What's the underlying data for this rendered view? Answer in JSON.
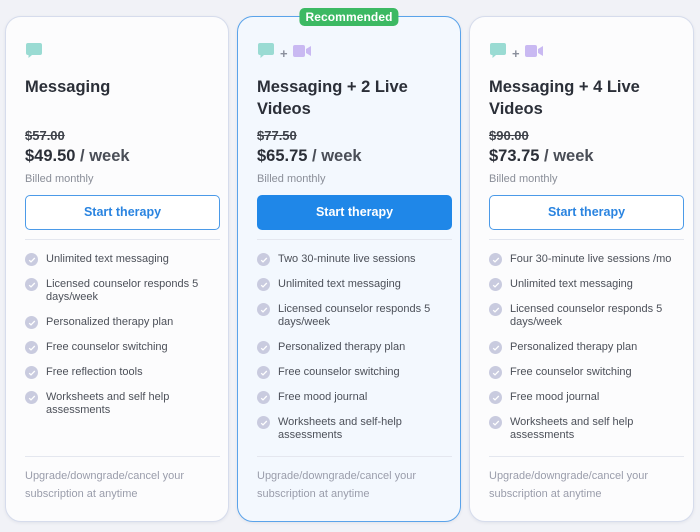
{
  "colors": {
    "accent": "#1f87e8",
    "recommended_badge": "#3cb963",
    "message_icon": "#9adbd3",
    "video_icon": "#c9b9f2",
    "check_icon": "#c9cbdf"
  },
  "plans": [
    {
      "icons": [
        "message-icon"
      ],
      "title": "Messaging",
      "old_price": "$57.00",
      "price": "$49.50",
      "period": " / week",
      "billing": "Billed monthly",
      "cta": "Start therapy",
      "recommended": false,
      "features": [
        "Unlimited text messaging",
        "Licensed counselor responds 5 days/week",
        "Personalized therapy plan",
        "Free counselor switching",
        "Free reflection tools",
        "Worksheets and self help assessments"
      ],
      "footer": "Upgrade/downgrade/cancel your subscription at anytime"
    },
    {
      "icons": [
        "message-icon",
        "video-icon"
      ],
      "badge": "Recommended",
      "title": "Messaging + 2 Live Videos",
      "old_price": "$77.50",
      "price": "$65.75",
      "period": " / week",
      "billing": "Billed monthly",
      "cta": "Start therapy",
      "recommended": true,
      "features": [
        "Two 30-minute live sessions",
        "Unlimited text messaging",
        "Licensed counselor responds 5 days/week",
        "Personalized therapy plan",
        "Free counselor switching",
        "Free mood journal",
        "Worksheets and self-help assessments"
      ],
      "footer": "Upgrade/downgrade/cancel your subscription at anytime"
    },
    {
      "icons": [
        "message-icon",
        "video-icon"
      ],
      "title": "Messaging + 4 Live Videos",
      "old_price": "$90.00",
      "price": "$73.75",
      "period": " / week",
      "billing": "Billed monthly",
      "cta": "Start therapy",
      "recommended": false,
      "features": [
        "Four 30-minute live sessions /mo",
        "Unlimited text messaging",
        "Licensed counselor responds 5 days/week",
        "Personalized therapy plan",
        "Free counselor switching",
        "Free mood journal",
        "Worksheets and self help assessments"
      ],
      "footer": "Upgrade/downgrade/cancel your subscription at anytime"
    }
  ],
  "plus_sign": "+"
}
